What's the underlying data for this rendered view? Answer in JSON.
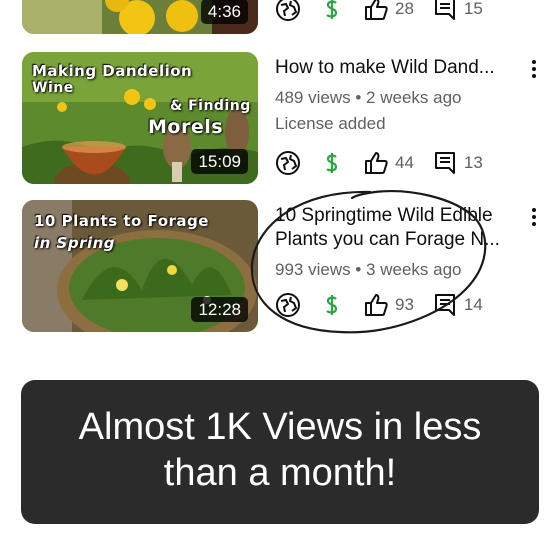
{
  "videos": [
    {
      "duration": "4:36",
      "stats": {
        "likes": "28",
        "comments": "15"
      }
    },
    {
      "title": "How to make Wild Dand...",
      "views": "489 views",
      "age": "2 weeks ago",
      "license": "License added",
      "duration": "15:09",
      "thumb_text": [
        "Making Dandelion",
        "Wine",
        "& Finding",
        "Morels"
      ],
      "stats": {
        "likes": "44",
        "comments": "13"
      }
    },
    {
      "title_line1": "10 Springtime Wild Edible",
      "title_line2": "Plants you can Forage N...",
      "views": "993 views",
      "age": "3 weeks ago",
      "duration": "12:28",
      "thumb_text": [
        "10 Plants to Forage",
        "in Spring"
      ],
      "stats": {
        "likes": "93",
        "comments": "14"
      }
    }
  ],
  "separator": "•",
  "icons": [
    "globe-icon",
    "dollar-icon",
    "thumbs-up-icon",
    "comment-icon",
    "more-vert-icon"
  ],
  "banner": {
    "line1": "Almost 1K Views in less",
    "line2": "than a month!"
  },
  "colors": {
    "banner_bg": "#2b2b2b",
    "meta_text": "#606060",
    "monetized": "#2ba640"
  }
}
